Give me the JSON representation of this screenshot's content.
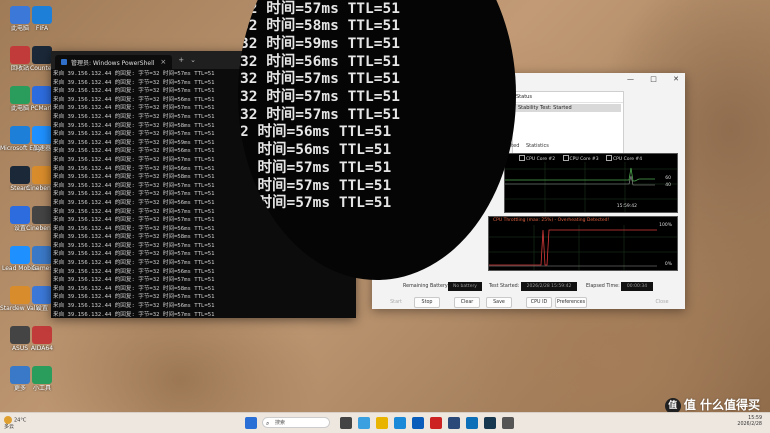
{
  "desktop": {
    "icons_col1": [
      "此电脑",
      "回收站",
      "此电脑",
      "Microsoft Edge",
      "Steam",
      "设置",
      "Lead Mobile",
      "Stardew Valley",
      "ASUS",
      "更多"
    ],
    "icons_col2": [
      "FIFA",
      "Counter",
      "PCMark",
      "加速器",
      "Cinebench",
      "Cinebench",
      "Games",
      "设置",
      "AIDA64",
      "小工具"
    ]
  },
  "powershell": {
    "tab_title": "管理员: Windows PowerShell",
    "lines": [
      "来自 39.156.132.44 的回复: 字节=32 时间=57ms TTL=51",
      "来自 39.156.132.44 的回复: 字节=32 时间=57ms TTL=51",
      "来自 39.156.132.44 的回复: 字节=32 时间=57ms TTL=51",
      "来自 39.156.132.44 的回复: 字节=32 时间=56ms TTL=51",
      "来自 39.156.132.44 的回复: 字节=32 时间=57ms TTL=51",
      "来自 39.156.132.44 的回复: 字节=32 时间=57ms TTL=51",
      "来自 39.156.132.44 的回复: 字节=32 时间=58ms TTL=51",
      "来自 39.156.132.44 的回复: 字节=32 时间=57ms TTL=51",
      "来自 39.156.132.44 的回复: 字节=32 时间=59ms TTL=51",
      "来自 39.156.132.44 的回复: 字节=32 时间=56ms TTL=51",
      "来自 39.156.132.44 的回复: 字节=32 时间=57ms TTL=51",
      "来自 39.156.132.44 的回复: 字节=32 时间=56ms TTL=51",
      "来自 39.156.132.44 的回复: 字节=32 时间=58ms TTL=51",
      "来自 39.156.132.44 的回复: 字节=32 时间=57ms TTL=51",
      "来自 39.156.132.44 的回复: 字节=32 时间=57ms TTL=51",
      "来自 39.156.132.44 的回复: 字节=32 时间=56ms TTL=51",
      "来自 39.156.132.44 的回复: 字节=32 时间=57ms TTL=51",
      "来自 39.156.132.44 的回复: 字节=32 时间=57ms TTL=51",
      "来自 39.156.132.44 的回复: 字节=32 时间=56ms TTL=51",
      "来自 39.156.132.44 的回复: 字节=32 时间=58ms TTL=51",
      "来自 39.156.132.44 的回复: 字节=32 时间=57ms TTL=51",
      "来自 39.156.132.44 的回复: 字节=32 时间=57ms TTL=51",
      "来自 39.156.132.44 的回复: 字节=32 时间=57ms TTL=51",
      "来自 39.156.132.44 的回复: 字节=32 时间=56ms TTL=51",
      "来自 39.156.132.44 的回复: 字节=32 时间=57ms TTL=51",
      "来自 39.156.132.44 的回复: 字节=32 时间=58ms TTL=51",
      "来自 39.156.132.44 的回复: 字节=32 时间=57ms TTL=51",
      "来自 39.156.132.44 的回复: 字节=32 时间=56ms TTL=51",
      "来自 39.156.132.44 的回复: 字节=32 时间=57ms TTL=51"
    ]
  },
  "magnifier": {
    "lines": [
      "  时间=57ms TTL=51",
      "  时间=57ms TTL=51",
      "  时间=57ms TTL=51",
      "32 时间=56ms TTL=51",
      "32 时间=57ms TTL=51",
      "32 时间=57ms TTL=51",
      "32 时间=58ms TTL=51",
      "32 时间=59ms TTL=51",
      "32 时间=56ms TTL=51",
      "32 时间=57ms TTL=51",
      "32 时间=57ms TTL=51",
      "32 时间=57ms TTL=51",
      "2 时间=56ms TTL=51",
      "  时间=56ms TTL=51",
      "  时间=57ms TTL=51",
      "  时间=57ms TTL=51",
      "  时间=57ms TTL=51"
    ]
  },
  "stability": {
    "controls": [
      "—",
      "□",
      "✕"
    ],
    "status_header": "Status",
    "status_row": "Stability Test: Started",
    "tabs": [
      "nted",
      "Statistics"
    ],
    "temp_legend": [
      "CPU Core #2",
      "CPU Core #3",
      "CPU Core #4"
    ],
    "temp_r1": "60",
    "temp_r2": "40",
    "temp_time": "15:59:42",
    "cpu_title": "CPU Throttling (max: 25%) - Overheating Detected!",
    "cpu_top": "100%",
    "cpu_bot": "0%",
    "remaining_battery_label": "Remaining Battery:",
    "remaining_battery_value": "No battery",
    "test_started_label": "Test Started:",
    "test_started_value": "2026/2/28 15:59:42",
    "elapsed_label": "Elapsed Time:",
    "elapsed_value": "00:00:34",
    "buttons": [
      "Start",
      "Stop",
      "Clear",
      "Save",
      "CPU ID",
      "Preferences",
      "Close"
    ],
    "colors": {
      "temp_line": "#4fa84f",
      "cpu_line": "#d83a3a",
      "cpu_title": "#e06040"
    }
  },
  "taskbar": {
    "weather_temp": "24°C",
    "weather_desc": "多云",
    "search_placeholder": "搜索",
    "time": "15:59",
    "date": "2026/2/28"
  },
  "watermark": {
    "text": "值 什么值得买"
  }
}
